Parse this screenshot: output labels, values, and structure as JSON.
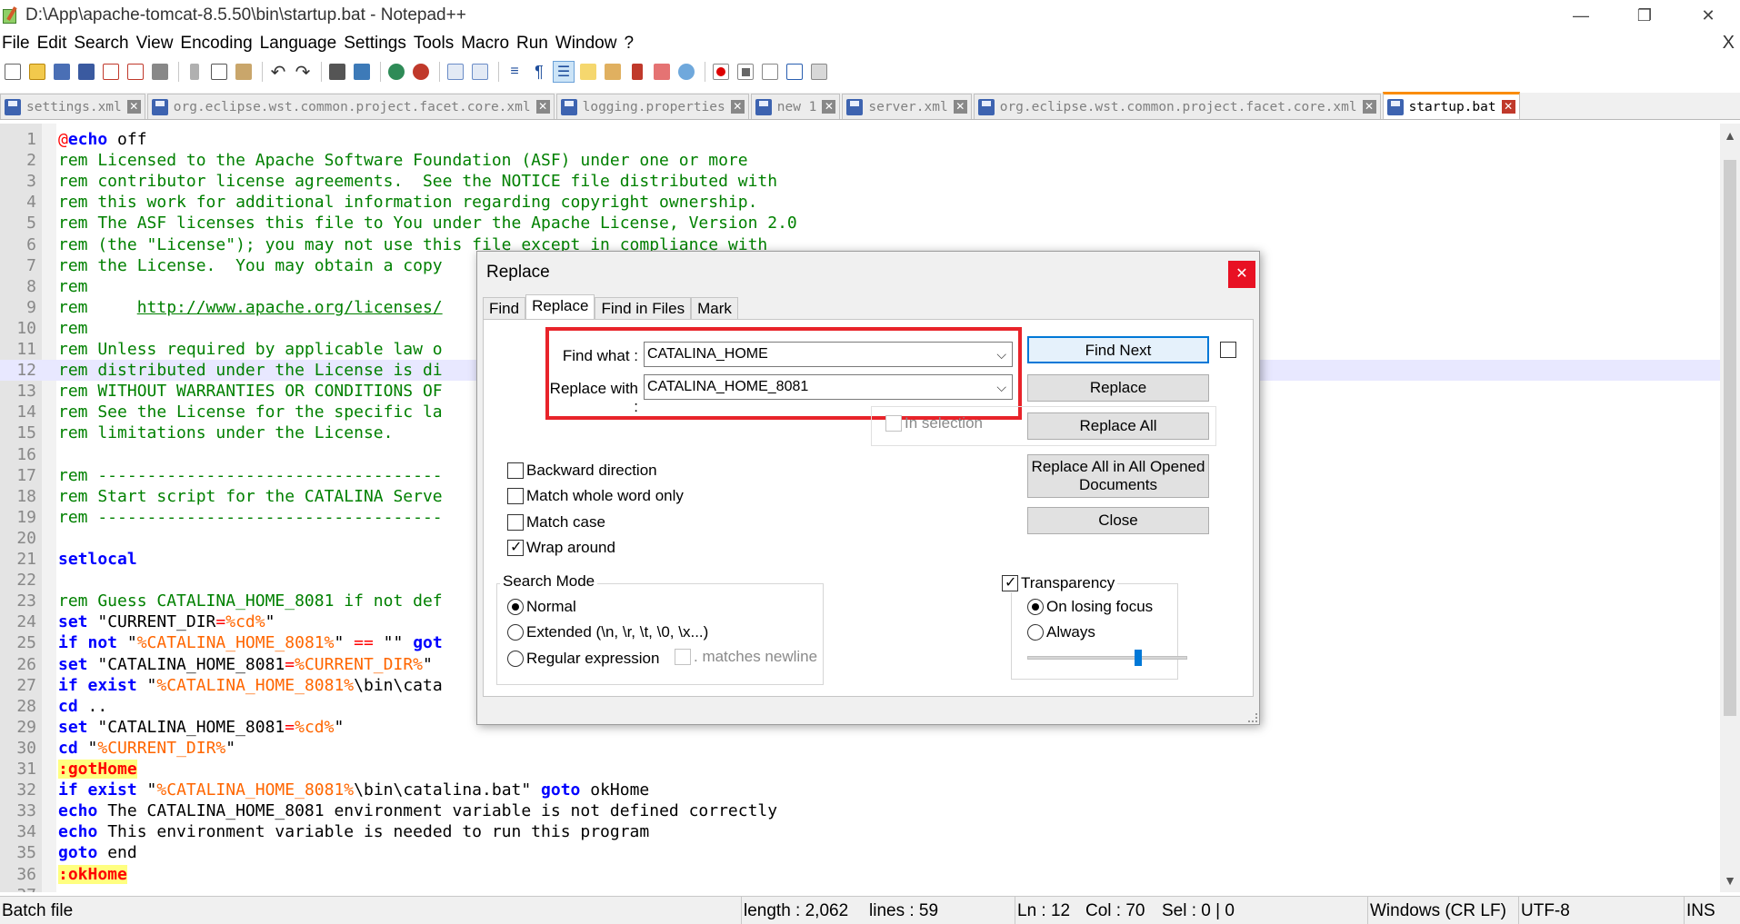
{
  "window": {
    "title": "D:\\App\\apache-tomcat-8.5.50\\bin\\startup.bat - Notepad++",
    "minimize": "—",
    "restore": "❐",
    "close": "✕"
  },
  "menu": [
    "File",
    "Edit",
    "Search",
    "View",
    "Encoding",
    "Language",
    "Settings",
    "Tools",
    "Macro",
    "Run",
    "Window",
    "?"
  ],
  "menu_close": "X",
  "tabs": [
    {
      "label": "settings.xml",
      "active": false
    },
    {
      "label": "org.eclipse.wst.common.project.facet.core.xml",
      "active": false
    },
    {
      "label": "logging.properties",
      "active": false
    },
    {
      "label": "new 1",
      "active": false
    },
    {
      "label": "server.xml",
      "active": false
    },
    {
      "label": "org.eclipse.wst.common.project.facet.core.xml",
      "active": false
    },
    {
      "label": "startup.bat",
      "active": true
    }
  ],
  "tab_close_glyph": "✕",
  "editor": {
    "current_line": 12,
    "lines": [
      {
        "n": "1",
        "parts": [
          [
            "op",
            "@"
          ],
          [
            "kw",
            "echo"
          ],
          [
            "plain",
            " off"
          ]
        ]
      },
      {
        "n": "2",
        "parts": [
          [
            "cm",
            "rem Licensed to the Apache Software Foundation (ASF) under one or more"
          ]
        ]
      },
      {
        "n": "3",
        "parts": [
          [
            "cm",
            "rem contributor license agreements.  See the NOTICE file distributed with"
          ]
        ]
      },
      {
        "n": "4",
        "parts": [
          [
            "cm",
            "rem this work for additional information regarding copyright ownership."
          ]
        ]
      },
      {
        "n": "5",
        "parts": [
          [
            "cm",
            "rem The ASF licenses this file to You under the Apache License, Version 2.0"
          ]
        ]
      },
      {
        "n": "6",
        "parts": [
          [
            "cm",
            "rem (the \"License\"); you may not use this file except in compliance with"
          ]
        ]
      },
      {
        "n": "7",
        "parts": [
          [
            "cm",
            "rem the License.  You may obtain a copy"
          ]
        ]
      },
      {
        "n": "8",
        "parts": [
          [
            "cm",
            "rem"
          ]
        ]
      },
      {
        "n": "9",
        "parts": [
          [
            "cm",
            "rem     "
          ],
          [
            "link",
            "http://www.apache.org/licenses/"
          ]
        ]
      },
      {
        "n": "10",
        "parts": [
          [
            "cm",
            "rem"
          ]
        ]
      },
      {
        "n": "11",
        "parts": [
          [
            "cm",
            "rem Unless required by applicable law o"
          ]
        ]
      },
      {
        "n": "12",
        "parts": [
          [
            "cm",
            "rem distributed under the License is di"
          ]
        ]
      },
      {
        "n": "13",
        "parts": [
          [
            "cm",
            "rem WITHOUT WARRANTIES OR CONDITIONS OF"
          ]
        ]
      },
      {
        "n": "14",
        "parts": [
          [
            "cm",
            "rem See the License for the specific la"
          ]
        ]
      },
      {
        "n": "15",
        "parts": [
          [
            "cm",
            "rem limitations under the License."
          ]
        ]
      },
      {
        "n": "16",
        "parts": [
          [
            "plain",
            ""
          ]
        ]
      },
      {
        "n": "17",
        "parts": [
          [
            "cm",
            "rem -----------------------------------"
          ]
        ]
      },
      {
        "n": "18",
        "parts": [
          [
            "cm",
            "rem Start script for the CATALINA Serve"
          ]
        ]
      },
      {
        "n": "19",
        "parts": [
          [
            "cm",
            "rem -----------------------------------"
          ]
        ]
      },
      {
        "n": "20",
        "parts": [
          [
            "plain",
            ""
          ]
        ]
      },
      {
        "n": "21",
        "parts": [
          [
            "kw",
            "setlocal"
          ]
        ]
      },
      {
        "n": "22",
        "parts": [
          [
            "plain",
            ""
          ]
        ]
      },
      {
        "n": "23",
        "parts": [
          [
            "cm",
            "rem Guess CATALINA_HOME_8081 if not def"
          ]
        ]
      },
      {
        "n": "24",
        "parts": [
          [
            "kw",
            "set"
          ],
          [
            "plain",
            " \"CURRENT_DIR"
          ],
          [
            "op",
            "="
          ],
          [
            "var",
            "%cd%"
          ],
          [
            "plain",
            "\""
          ]
        ]
      },
      {
        "n": "25",
        "parts": [
          [
            "kw",
            "if not"
          ],
          [
            "plain",
            " \""
          ],
          [
            "var",
            "%CATALINA_HOME_8081%"
          ],
          [
            "plain",
            "\" "
          ],
          [
            "op",
            "=="
          ],
          [
            "plain",
            " \"\" "
          ],
          [
            "kw",
            "got"
          ]
        ]
      },
      {
        "n": "26",
        "parts": [
          [
            "kw",
            "set"
          ],
          [
            "plain",
            " \"CATALINA_HOME_8081"
          ],
          [
            "op",
            "="
          ],
          [
            "var",
            "%CURRENT_DIR%"
          ],
          [
            "plain",
            "\""
          ]
        ]
      },
      {
        "n": "27",
        "parts": [
          [
            "kw",
            "if exist"
          ],
          [
            "plain",
            " \""
          ],
          [
            "var",
            "%CATALINA_HOME_8081%"
          ],
          [
            "plain",
            "\\bin\\cata"
          ]
        ]
      },
      {
        "n": "28",
        "parts": [
          [
            "kw",
            "cd"
          ],
          [
            "plain",
            " .."
          ]
        ]
      },
      {
        "n": "29",
        "parts": [
          [
            "kw",
            "set"
          ],
          [
            "plain",
            " \"CATALINA_HOME_8081"
          ],
          [
            "op",
            "="
          ],
          [
            "var",
            "%cd%"
          ],
          [
            "plain",
            "\""
          ]
        ]
      },
      {
        "n": "30",
        "parts": [
          [
            "kw",
            "cd"
          ],
          [
            "plain",
            " \""
          ],
          [
            "var",
            "%CURRENT_DIR%"
          ],
          [
            "plain",
            "\""
          ]
        ]
      },
      {
        "n": "31",
        "parts": [
          [
            "lbl",
            ":gotHome"
          ]
        ]
      },
      {
        "n": "32",
        "parts": [
          [
            "kw",
            "if exist"
          ],
          [
            "plain",
            " \""
          ],
          [
            "var",
            "%CATALINA_HOME_8081%"
          ],
          [
            "plain",
            "\\bin\\catalina.bat\" "
          ],
          [
            "kw",
            "goto"
          ],
          [
            "plain",
            " okHome"
          ]
        ]
      },
      {
        "n": "33",
        "parts": [
          [
            "kw",
            "echo"
          ],
          [
            "plain",
            " The CATALINA_HOME_8081 environment variable is not defined correctly"
          ]
        ]
      },
      {
        "n": "34",
        "parts": [
          [
            "kw",
            "echo"
          ],
          [
            "plain",
            " This environment variable is needed to run this program"
          ]
        ]
      },
      {
        "n": "35",
        "parts": [
          [
            "kw",
            "goto"
          ],
          [
            "plain",
            " end"
          ]
        ]
      },
      {
        "n": "36",
        "parts": [
          [
            "lbl",
            ":okHome"
          ]
        ]
      },
      {
        "n": "37",
        "parts": [
          [
            "plain",
            ""
          ]
        ]
      }
    ]
  },
  "scrollbar": {
    "up": "▲",
    "down": "▼"
  },
  "statusbar": {
    "file_type": "Batch file",
    "length": "length : 2,062",
    "lines": "lines : 59",
    "ln": "Ln : 12",
    "col": "Col : 70",
    "sel": "Sel : 0 | 0",
    "eol": "Windows (CR LF)",
    "encoding": "UTF-8",
    "mode": "INS"
  },
  "dialog": {
    "title": "Replace",
    "close": "✕",
    "tabs": [
      "Find",
      "Replace",
      "Find in Files",
      "Mark"
    ],
    "active_tab": "Replace",
    "find_label": "Find what :",
    "find_value": "CATALINA_HOME",
    "replace_label": "Replace with :",
    "replace_value": "CATALINA_HOME_8081",
    "buttons": {
      "find_next": "Find Next",
      "replace": "Replace",
      "replace_all": "Replace All",
      "replace_all_opened": "Replace All in All Opened Documents",
      "close": "Close"
    },
    "in_selection": "In selection",
    "options": {
      "backward": {
        "label": "Backward direction",
        "checked": false
      },
      "whole_word": {
        "label": "Match whole word only",
        "checked": false
      },
      "match_case": {
        "label": "Match case",
        "checked": false
      },
      "wrap_around": {
        "label": "Wrap around",
        "checked": true
      }
    },
    "search_mode": {
      "title": "Search Mode",
      "normal": "Normal",
      "extended": "Extended (\\n, \\r, \\t, \\0, \\x...)",
      "regex": "Regular expression",
      "matches_newline": ". matches newline",
      "selected": "Normal"
    },
    "transparency": {
      "title": "Transparency",
      "checked": true,
      "on_losing_focus": "On losing focus",
      "always": "Always",
      "selected": "On losing focus",
      "level": 0.7
    },
    "chevron": "⌵"
  },
  "colors": {
    "accent_tab": "#fa8c00",
    "highlight_box": "#e8232a",
    "comment": "#008000",
    "keyword": "#0000ff",
    "variable": "#ff6600"
  }
}
